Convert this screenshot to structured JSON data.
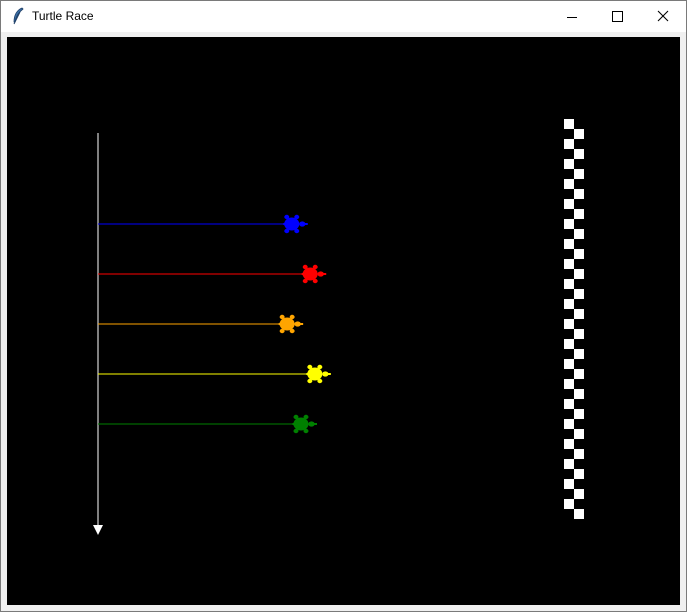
{
  "window": {
    "title": "Turtle Race"
  },
  "icons": {
    "app": "feather-icon",
    "minimize": "minimize-icon",
    "maximize": "maximize-icon",
    "close": "close-icon"
  },
  "race": {
    "background": "#000000",
    "start_line_color": "#ffffff",
    "racers": [
      {
        "color": "blue",
        "hex": "#0000ff",
        "progress": 0.42
      },
      {
        "color": "red",
        "hex": "#ff0000",
        "progress": 0.46
      },
      {
        "color": "orange",
        "hex": "#ffa500",
        "progress": 0.41
      },
      {
        "color": "yellow",
        "hex": "#ffff00",
        "progress": 0.47
      },
      {
        "color": "green",
        "hex": "#008000",
        "progress": 0.44
      }
    ],
    "finish_line": {
      "colors": [
        "#ffffff",
        "#000000"
      ]
    }
  }
}
